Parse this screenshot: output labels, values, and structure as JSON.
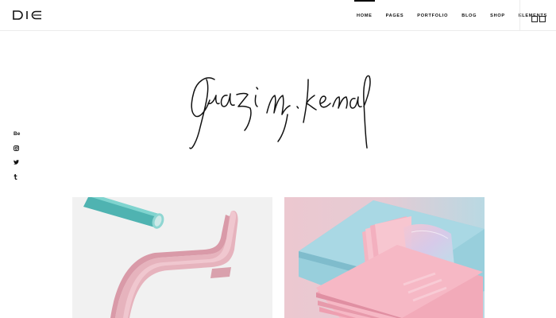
{
  "logo": {
    "text": "DIC",
    "icon": "dic-logo"
  },
  "nav": {
    "items": [
      {
        "label": "HOME",
        "active": true
      },
      {
        "label": "PAGES"
      },
      {
        "label": "PORTFOLIO"
      },
      {
        "label": "BLOG"
      },
      {
        "label": "SHOP"
      },
      {
        "label": "ELEMENTS"
      }
    ],
    "sidearea_icon": "two-squares-icon"
  },
  "social": [
    {
      "label": "Be",
      "icon": "behance-icon"
    },
    {
      "icon": "instagram-icon"
    },
    {
      "icon": "twitter-icon"
    },
    {
      "icon": "tumblr-icon"
    }
  ],
  "hero": {
    "signature_text": "Gazi M. Kemal",
    "signature_icon": "handwritten-signature"
  },
  "portfolio": [
    {
      "image": "pink-bent-ribbon-teal-cylinder",
      "colors": [
        "#f1f1f1",
        "#e8b9c5",
        "#6fc3c3"
      ]
    },
    {
      "image": "pink-business-cards-on-blue",
      "colors": [
        "#ebc7cf",
        "#9fd2de",
        "#f2a9b8"
      ]
    }
  ]
}
